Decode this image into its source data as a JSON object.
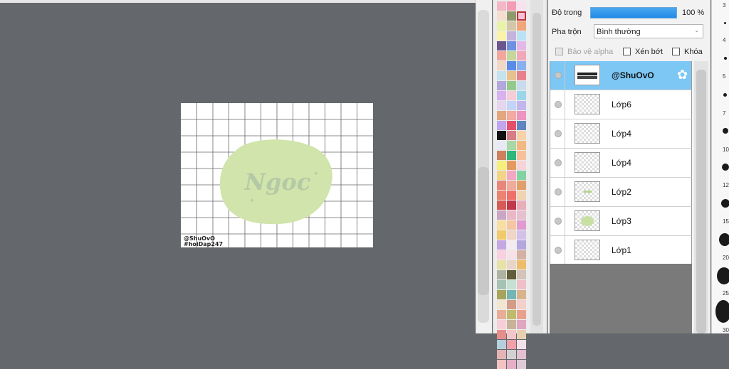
{
  "canvas": {
    "artwork_text": "Ngoc",
    "credit_line1": "@ShuOvO",
    "credit_line2": "#hoiDap247"
  },
  "palette": {
    "colors": [
      "#f3b7c5",
      "#f49cb5",
      "#f7e2ed",
      "#f5ddd0",
      "#8e9a6c",
      "#f7c1d8",
      "#e9f2a8",
      "#d2c7a8",
      "#f0a57b",
      "#fbf3a8",
      "#c4b4dc",
      "#b9e3f5",
      "#6c5690",
      "#6f90e2",
      "#e4b8e6",
      "#f3a79c",
      "#c5d79a",
      "#f1a9b9",
      "#f3d7c6",
      "#5a8be5",
      "#8ab1ef",
      "#c5e2ef",
      "#e7c28e",
      "#e9818c",
      "#b3a7dd",
      "#94c98c",
      "#c8dced",
      "#d7b1f0",
      "#f5ccd7",
      "#9cd6e9",
      "#e5d5ef",
      "#c2d5f7",
      "#c2b6ed",
      "#e2a77e",
      "#f3aaa1",
      "#ed94c0",
      "#c3a4ee",
      "#e54e6b",
      "#5f86c0",
      "#101010",
      "#d67e88",
      "#f7d2a8",
      "#e7e9f5",
      "#a9d7a6",
      "#f3b980",
      "#cc8060",
      "#2fb67a",
      "#f6c09a",
      "#f5f07a",
      "#e59a5d",
      "#f7d3da",
      "#f3d487",
      "#f2a7c2",
      "#82d3a4",
      "#e9867a",
      "#f0ab9c",
      "#e29e6b",
      "#ec8272",
      "#ef6f6a",
      "#f1d2b3",
      "#d75b55",
      "#c1384a",
      "#e8aeb9",
      "#c9a6c6",
      "#e9b7c5",
      "#e6c0cf",
      "#f7dfa3",
      "#f4c6a2",
      "#e19bd0",
      "#f2c96b",
      "#efd6c6",
      "#d3c1e7",
      "#c5a8e3",
      "#f3ebf1",
      "#b3a7dd",
      "#f9d0de",
      "#f7e1e8",
      "#d4b1a2",
      "#e6e2a8",
      "#e7d6c8",
      "#eebd6b",
      "#aeb3a1",
      "#5f5e39",
      "#d3c3b8",
      "#a6c2b6",
      "#c4e1d3",
      "#efc0c8",
      "#a8a45c",
      "#73b6b4",
      "#d7b48c",
      "#f1e6cf",
      "#d29c87",
      "#f3d0cc",
      "#e7ad96",
      "#c0bb6c",
      "#e9a18e",
      "#f7cfd9",
      "#c8b39a",
      "#e0a7c0",
      "#e68e8b",
      "#f2c7c9",
      "#e7d0b0",
      "#b5d0dc",
      "#f0a0a8",
      "#f3e2e7",
      "#e4b4b5",
      "#d1d1d1",
      "#e4c0d1",
      "#f1c3c2",
      "#e5b0c6",
      "#dfcbd8"
    ],
    "selected_index": 5
  },
  "layer_panel": {
    "opacity_label": "Độ trong",
    "opacity_value": "100 %",
    "blend_label": "Pha trộn",
    "blend_value": "Bình thường",
    "protect_alpha_label": "Bảo vệ alpha",
    "clip_label": "Xén bớt",
    "lock_label": "Khóa",
    "layers": [
      {
        "name": "@ShuOvO",
        "active": true
      },
      {
        "name": "Lớp6",
        "active": false
      },
      {
        "name": "Lớp4",
        "active": false
      },
      {
        "name": "Lớp4",
        "active": false
      },
      {
        "name": "Lớp2",
        "active": false
      },
      {
        "name": "Lớp3",
        "active": false
      },
      {
        "name": "Lớp1",
        "active": false
      }
    ]
  },
  "brush_sizes": [
    "3",
    "4",
    "5",
    "7",
    "10",
    "12",
    "15",
    "20",
    "25",
    "30"
  ]
}
